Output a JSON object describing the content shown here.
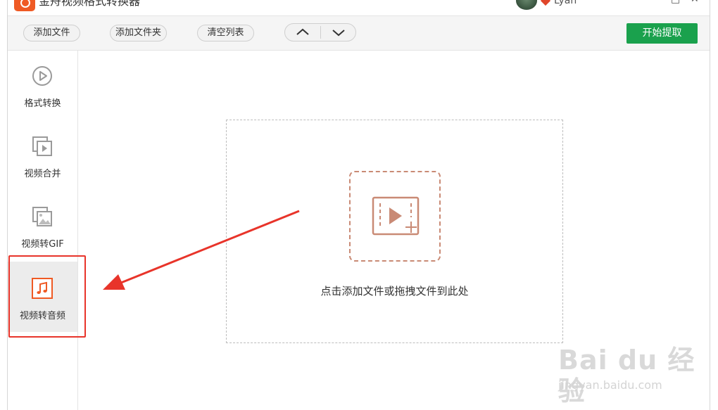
{
  "app": {
    "title": "金舟视频格式转换器",
    "username": "Lyan"
  },
  "window_controls": {
    "minimize": "—",
    "maximize": "□",
    "close": "✕"
  },
  "toolbar": {
    "add_file": "添加文件",
    "add_folder": "添加文件夹",
    "clear_list": "清空列表",
    "move_up_icon": "chevron-up-icon",
    "move_down_icon": "chevron-down-icon",
    "start": "开始提取"
  },
  "sidebar": {
    "items": [
      {
        "label": "格式转换",
        "icon": "play-circle-icon",
        "active": false
      },
      {
        "label": "视频合并",
        "icon": "video-merge-icon",
        "active": false
      },
      {
        "label": "视频转GIF",
        "icon": "image-gif-icon",
        "active": false
      },
      {
        "label": "视频转音频",
        "icon": "music-note-icon",
        "active": true
      }
    ]
  },
  "main": {
    "drop_hint": "点击添加文件或拖拽文件到此处"
  },
  "colors": {
    "accent_green": "#1aa14d",
    "active_orange": "#ef5a24",
    "drop_icon": "#c98a75",
    "annotation_red": "#e8342a"
  },
  "watermark": {
    "logo": "Bai du 经验",
    "url": "jingyan.baidu.com"
  }
}
